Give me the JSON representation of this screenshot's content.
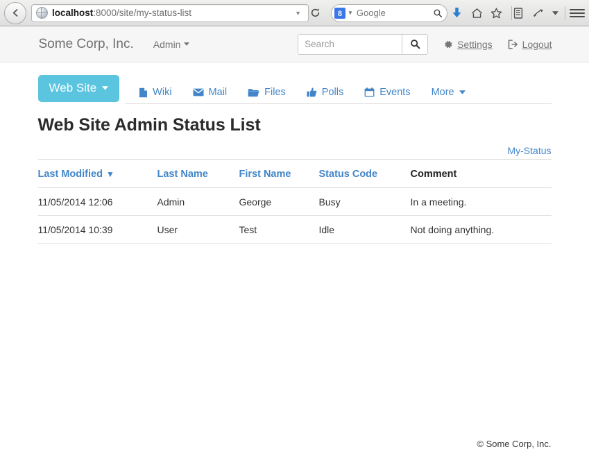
{
  "browser": {
    "back_label": "←",
    "url_host": "localhost",
    "url_path": ":8000/site/my-status-list",
    "url_dropdown_icon": "▼",
    "reload_icon": "⟳",
    "search_engine_badge": "8",
    "search_engine_caret": "▼",
    "search_engine_label": "Google",
    "search_magnifier": "⚲",
    "toolbar_icons": [
      {
        "name": "download-icon",
        "glyph": "↓"
      },
      {
        "name": "home-icon",
        "glyph": "⌂"
      },
      {
        "name": "bookmark-star-icon",
        "glyph": "☆"
      },
      {
        "name": "reading-list-icon",
        "glyph": "▤"
      },
      {
        "name": "pocket-icon",
        "glyph": "✒"
      },
      {
        "name": "overflow-caret-icon",
        "glyph": "▼"
      }
    ]
  },
  "header": {
    "brand": "Some Corp, Inc.",
    "user_menu": "Admin",
    "user_menu_caret": "▼",
    "search_placeholder": "Search",
    "search_value": "",
    "search_button_icon": "⚲",
    "settings_label": "Settings",
    "logout_label": "Logout"
  },
  "nav": {
    "site_button": "Web Site",
    "site_button_caret": "▾",
    "links": [
      {
        "label": "Wiki",
        "icon": "file-icon"
      },
      {
        "label": "Mail",
        "icon": "envelope-icon"
      },
      {
        "label": "Files",
        "icon": "folder-open-icon"
      },
      {
        "label": "Polls",
        "icon": "thumbs-up-icon"
      },
      {
        "label": "Events",
        "icon": "calendar-icon"
      },
      {
        "label": "More",
        "icon": "none",
        "caret": "▾"
      }
    ]
  },
  "page": {
    "title": "Web Site Admin Status List",
    "sublink": "My-Status"
  },
  "table": {
    "columns": [
      {
        "label": "Last Modified",
        "sortable": true,
        "sort_arrow": "▼"
      },
      {
        "label": "Last Name",
        "sortable": true,
        "sort_arrow": ""
      },
      {
        "label": "First Name",
        "sortable": true,
        "sort_arrow": ""
      },
      {
        "label": "Status Code",
        "sortable": true,
        "sort_arrow": ""
      },
      {
        "label": "Comment",
        "sortable": false,
        "sort_arrow": ""
      }
    ],
    "rows": [
      {
        "last_modified": "11/05/2014 12:06",
        "last_name": "Admin",
        "first_name": "George",
        "status_code": "Busy",
        "comment": "In a meeting."
      },
      {
        "last_modified": "11/05/2014 10:39",
        "last_name": "User",
        "first_name": "Test",
        "status_code": "Idle",
        "comment": "Not doing anything."
      }
    ]
  },
  "footer": {
    "copyright": "© Some Corp, Inc."
  },
  "colors": {
    "accent_blue": "#4285c9",
    "site_button": "#5bc4de",
    "header_bg": "#f6f6f6",
    "border": "#dddddd"
  }
}
